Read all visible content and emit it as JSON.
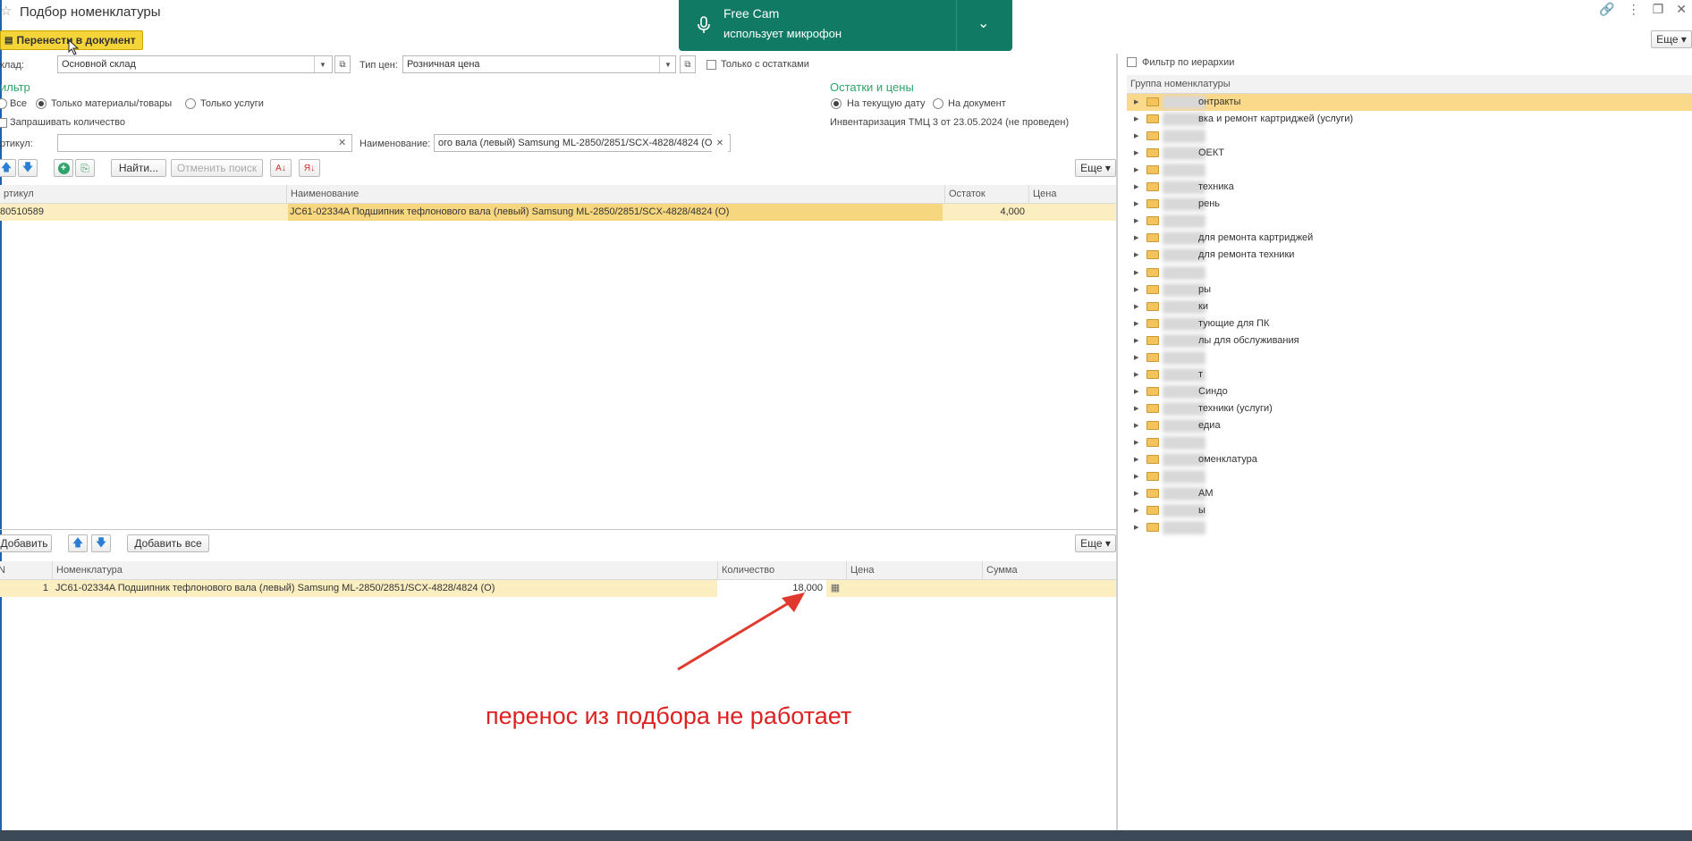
{
  "window": {
    "title": "Подбор номенклатуры",
    "more_label": "Еще"
  },
  "overlay": {
    "app": "Free Cam",
    "status": "использует микрофон"
  },
  "toolbar": {
    "transfer_label": "Перенести в документ",
    "warehouse_label": "клад:",
    "warehouse_value": "Основной склад",
    "price_type_label": "Тип цен:",
    "price_type_value": "Розничная цена",
    "only_stock_label": "Только с остатками"
  },
  "filter": {
    "header": "ильтр",
    "radio_all": "Все",
    "radio_materials": "Только материалы/товары",
    "radio_services": "Только услуги",
    "ask_quantity": "Запрашивать количество",
    "article_label": "ртикул:",
    "article_value": "",
    "name_label": "Наименование:",
    "name_value": "ого вала (левый) Samsung ML-2850/2851/SCX-4828/4824 (O)"
  },
  "stock": {
    "header": "Остатки и цены",
    "radio_current": "На текущую дату",
    "radio_doc": "На документ",
    "inventory": "Инвентаризация ТМЦ 3 от 23.05.2024 (не проведен)"
  },
  "search": {
    "find": "Найти...",
    "cancel": "Отменить поиск",
    "more": "Еще"
  },
  "top_table": {
    "columns": [
      "ртикул",
      "Наименование",
      "Остаток",
      "Цена"
    ],
    "rows": [
      {
        "article": "80510589",
        "name": "JC61-02334A Подшипник тефлонового вала (левый) Samsung ML-2850/2851/SCX-4828/4824 (O)",
        "stock": "4,000",
        "price": ""
      }
    ]
  },
  "bottom_toolbar": {
    "add": "Добавить",
    "add_all": "Добавить все",
    "more": "Еще"
  },
  "bottom_table": {
    "columns": [
      "N",
      "Номенклатура",
      "Количество",
      "Цена",
      "Сумма"
    ],
    "rows": [
      {
        "n": "1",
        "name": "JC61-02334A Подшипник тефлонового вала (левый) Samsung ML-2850/2851/SCX-4828/4824 (O)",
        "qty": "18,000",
        "price": "",
        "sum": ""
      }
    ]
  },
  "tree": {
    "filter_label": "Фильтр по иерархии",
    "header": "Группа номенклатуры",
    "items": [
      "онтракты",
      "вка и ремонт картриджей (услуги)",
      "",
      "ОЕКТ",
      "",
      "техника",
      "рень",
      "",
      "для ремонта картриджей",
      "для ремонта техники",
      "",
      "ры",
      "ки",
      "тующие для ПК",
      "лы для обслуживания",
      "",
      "т",
      "Синдо",
      "техники (услуги)",
      "едиа",
      "",
      "оменклатура",
      "",
      "АМ",
      "ы",
      ""
    ]
  },
  "annotation": {
    "text": "перенос из подбора не работает",
    "color": "#dd2222"
  }
}
